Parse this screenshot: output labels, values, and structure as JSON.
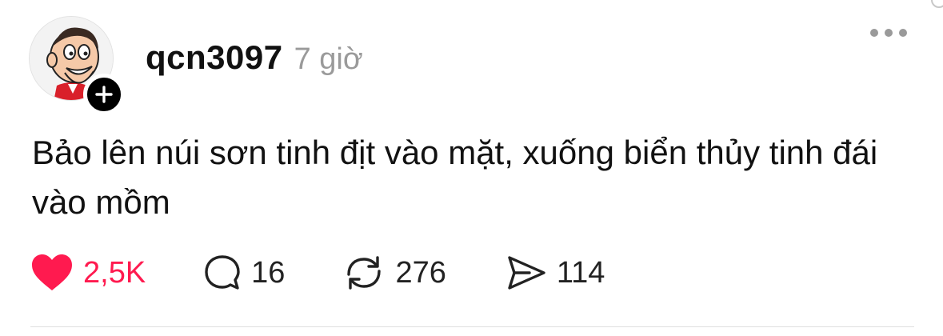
{
  "post": {
    "username": "qcn3097",
    "time": "7 giờ",
    "text": "Bảo lên núi sơn tinh địt vào mặt, xuống biển thủy tinh đái vào mồm"
  },
  "stats": {
    "likes": "2,5K",
    "comments": "16",
    "reposts": "276",
    "shares": "114"
  },
  "icons": {
    "avatar": "cartoon-avatar",
    "follow": "plus-icon",
    "more": "more-dots-icon",
    "like": "heart-icon",
    "comment": "comment-icon",
    "repost": "repost-icon",
    "share": "send-icon"
  },
  "colors": {
    "like_active": "#ff1a4f",
    "muted": "#9a9a9a",
    "text": "#111111"
  }
}
